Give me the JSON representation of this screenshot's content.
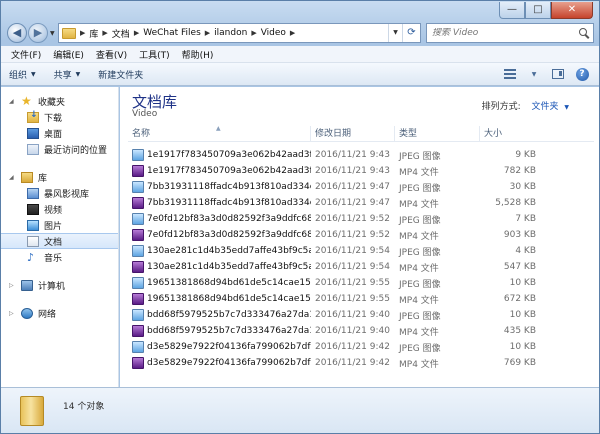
{
  "window": {
    "controls": {
      "minimize": "—",
      "maximize": "□",
      "close": "✕"
    }
  },
  "address": {
    "crumbs": [
      "库",
      "文档",
      "WeChat Files",
      "ilandon",
      "Video"
    ]
  },
  "search": {
    "placeholder": "搜索 Video"
  },
  "menu": [
    "文件(F)",
    "编辑(E)",
    "查看(V)",
    "工具(T)",
    "帮助(H)"
  ],
  "toolbar": {
    "organize": "组织",
    "share": "共享",
    "new_folder": "新建文件夹"
  },
  "nav": {
    "favorites": "收藏夹",
    "downloads": "下载",
    "desktop": "桌面",
    "recent": "最近访问的位置",
    "libraries": "库",
    "storm": "暴风影视库",
    "videos": "视频",
    "pictures": "图片",
    "documents": "文档",
    "music": "音乐",
    "computer": "计算机",
    "network": "网络"
  },
  "library": {
    "title": "文档库",
    "subtitle": "Video",
    "arrange_label": "排列方式:",
    "arrange_value": "文件夹"
  },
  "columns": {
    "name": "名称",
    "date": "修改日期",
    "type": "类型",
    "size": "大小"
  },
  "files": [
    {
      "name": "1e1917f783450709a3e062b42aad3f4...",
      "date": "2016/11/21 9:43",
      "type": "JPEG 图像",
      "size": "9 KB",
      "kind": "jpeg"
    },
    {
      "name": "1e1917f783450709a3e062b42aad3f4...",
      "date": "2016/11/21 9:43",
      "type": "MP4 文件",
      "size": "782 KB",
      "kind": "mp4"
    },
    {
      "name": "7bb31931118ffadc4b913f810ad334e...",
      "date": "2016/11/21 9:47",
      "type": "JPEG 图像",
      "size": "30 KB",
      "kind": "jpeg"
    },
    {
      "name": "7bb31931118ffadc4b913f810ad334e...",
      "date": "2016/11/21 9:47",
      "type": "MP4 文件",
      "size": "5,528 KB",
      "kind": "mp4"
    },
    {
      "name": "7e0fd12bf83a3d0d82592f3a9ddfc686...",
      "date": "2016/11/21 9:52",
      "type": "JPEG 图像",
      "size": "7 KB",
      "kind": "jpeg"
    },
    {
      "name": "7e0fd12bf83a3d0d82592f3a9ddfc686...",
      "date": "2016/11/21 9:52",
      "type": "MP4 文件",
      "size": "903 KB",
      "kind": "mp4"
    },
    {
      "name": "130ae281c1d4b35edd7affe43bf9c5af...",
      "date": "2016/11/21 9:54",
      "type": "JPEG 图像",
      "size": "4 KB",
      "kind": "jpeg"
    },
    {
      "name": "130ae281c1d4b35edd7affe43bf9c5af...",
      "date": "2016/11/21 9:54",
      "type": "MP4 文件",
      "size": "547 KB",
      "kind": "mp4"
    },
    {
      "name": "19651381868d94bd61de5c14cae15a...",
      "date": "2016/11/21 9:55",
      "type": "JPEG 图像",
      "size": "10 KB",
      "kind": "jpeg"
    },
    {
      "name": "19651381868d94bd61de5c14cae15a...",
      "date": "2016/11/21 9:55",
      "type": "MP4 文件",
      "size": "672 KB",
      "kind": "mp4"
    },
    {
      "name": "bdd68f5979525b7c7d333476a27da1...",
      "date": "2016/11/21 9:40",
      "type": "JPEG 图像",
      "size": "10 KB",
      "kind": "jpeg"
    },
    {
      "name": "bdd68f5979525b7c7d333476a27da1...",
      "date": "2016/11/21 9:40",
      "type": "MP4 文件",
      "size": "435 KB",
      "kind": "mp4"
    },
    {
      "name": "d3e5829e7922f04136fa799062b7df7...",
      "date": "2016/11/21 9:42",
      "type": "JPEG 图像",
      "size": "10 KB",
      "kind": "jpeg"
    },
    {
      "name": "d3e5829e7922f04136fa799062b7df7...",
      "date": "2016/11/21 9:42",
      "type": "MP4 文件",
      "size": "769 KB",
      "kind": "mp4"
    }
  ],
  "status": {
    "count": "14 个对象"
  }
}
